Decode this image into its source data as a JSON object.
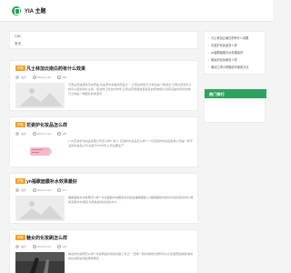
{
  "app": {
    "logo_text": "YIA 主题"
  },
  "breadcrumb": [
    "CBC",
    "首页"
  ],
  "articles": [
    {
      "badge": "护肤",
      "title": "凡士林加云南白药有什么效果",
      "author": "站长",
      "date": "2024-01-15",
      "views": "256",
      "excerpt": "云南白药是很常见的药品,也是家中常备的药品之一,云南白药和凡士林也是一种用法,云南白药加凡士林可以起到消炎止痛、促进伤口愈合的作用,云南白药里面含有很多的药物成分,具有活血化瘀的功效,凡士林是一种很好的保湿剂……",
      "thumb": "placeholder"
    },
    {
      "badge": "护肤",
      "title": "花姿护化妆品怎么样",
      "author": "站长",
      "date": "2024-01-14",
      "views": "189",
      "excerpt": "广州花姿护化妆品有限公司怎么样? 简介: 花姿护化妆品怎么样? 广州花姿护化妆品有限公司是一家专业的化妆品公司,创建于2005年,公司主要生产……",
      "thumb": "product"
    },
    {
      "badge": "护肤",
      "title": "yn福歌面膜补水效果最好",
      "author": "站长",
      "date": "2024-01-13",
      "views": "172",
      "excerpt": "福歌面膜补水效果怎么样? 补水面膜中效果最好的就是福歌面膜,yn福歌面膜中含有丰富的营养成分,能够深层补水保湿,为肌肤提供充足的水分……",
      "thumb": "placeholder"
    },
    {
      "badge": "护肤",
      "title": "魅女的化妆刷怎么样",
      "author": "站长",
      "date": "2024-01-12",
      "views": "143",
      "excerpt": "魅女的化妆刷怎么样? 化妆刷是化妆的必备工具之一,选择一款好用的化妆刷可以让妆容更加精致,魅女的化妆刷采用优质的刷毛……",
      "thumb": "brush"
    }
  ],
  "right_list": [
    "凡士林加云南白药有什么效果",
    "花姿护化妆品怎么样",
    "yn福歌面膜补水效果最好",
    "魅女的化妆刷怎么样",
    "雅诗兰黛小棕瓶精华使用方法"
  ],
  "hot": {
    "title": "热门排行"
  },
  "colors": {
    "accent": "#2ea35f",
    "badge": "#f0a020"
  }
}
